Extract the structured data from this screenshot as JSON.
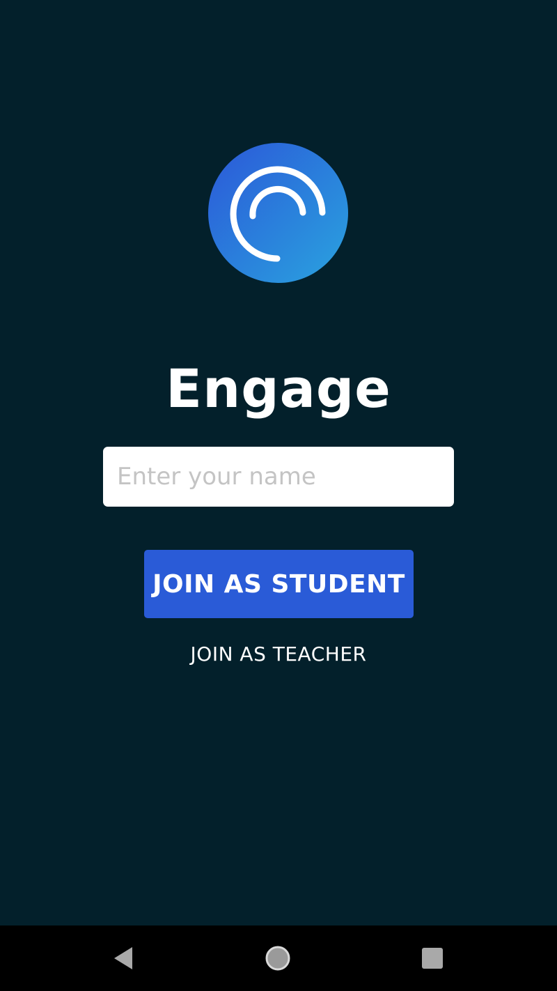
{
  "app": {
    "title": "Engage",
    "logo_icon": "engage-arc-logo",
    "accent_color": "#2a5bd7",
    "background_color": "#03202b"
  },
  "form": {
    "name_placeholder": "Enter your name",
    "name_value": "",
    "student_button_label": "JOIN AS STUDENT",
    "teacher_button_label": "JOIN AS TEACHER"
  },
  "navbar": {
    "back_icon": "back-triangle-icon",
    "home_icon": "home-circle-icon",
    "recents_icon": "recents-square-icon"
  }
}
